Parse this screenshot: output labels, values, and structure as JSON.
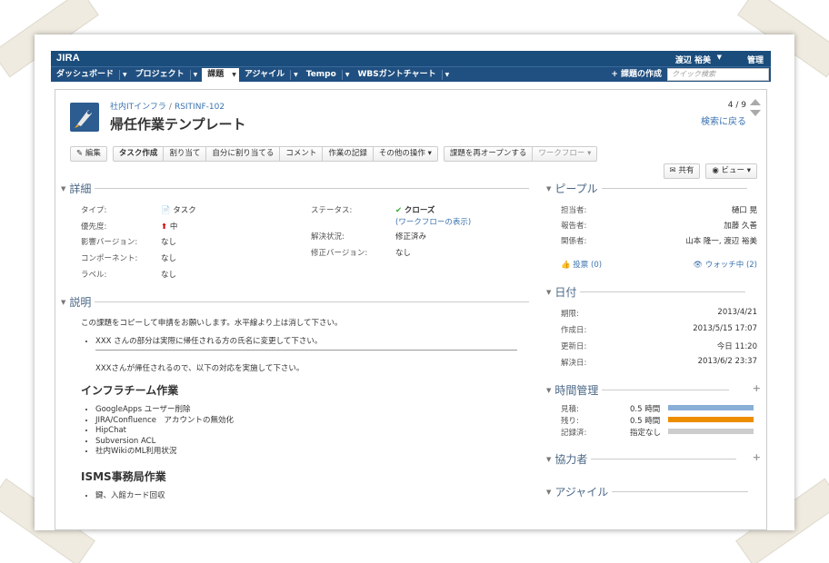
{
  "header": {
    "logo": "JIRA",
    "user": "渡辺 裕美",
    "admin": "管理"
  },
  "nav": {
    "items": [
      "ダッシュボード",
      "プロジェクト",
      "課題",
      "アジャイル",
      "Tempo",
      "WBSガントチャート"
    ],
    "create": "+ 課題の作成",
    "search_placeholder": "クイック検索"
  },
  "issue": {
    "project": "社内ITインフラ",
    "key": "RSITINF-102",
    "title": "帰任作業テンプレート",
    "position": "4 / 9",
    "back_to_search": "検索に戻る"
  },
  "toolbar": {
    "edit": "編集",
    "group1": [
      "タスク作成",
      "割り当て",
      "自分に割り当てる",
      "コメント",
      "作業の記録",
      "その他の操作 ▾"
    ],
    "reopen": "課題を再オープンする",
    "workflow": "ワークフロー ▾",
    "share": "共有",
    "view": "ビュー ▾"
  },
  "details": {
    "heading": "詳細",
    "left": [
      {
        "label": "タイプ:",
        "value": "タスク"
      },
      {
        "label": "優先度:",
        "value": "中"
      },
      {
        "label": "影響バージョン:",
        "value": "なし"
      },
      {
        "label": "コンポーネント:",
        "value": "なし"
      },
      {
        "label": "ラベル:",
        "value": "なし"
      }
    ],
    "right": [
      {
        "label": "ステータス:",
        "value": "クローズ"
      },
      {
        "label": "",
        "value": "(ワークフローの表示)"
      },
      {
        "label": "解決状況:",
        "value": "修正済み"
      },
      {
        "label": "修正バージョン:",
        "value": "なし"
      }
    ]
  },
  "description": {
    "heading": "説明",
    "intro": "この課題をコピーして申請をお願いします。水平線より上は消して下さい。",
    "bullet1": "XXX さんの部分は実際に帰任される方の氏名に変更して下さい。",
    "para": "XXXさんが帰任されるので、以下の対応を実施して下さい。",
    "h1": "インフラチーム作業",
    "list1": [
      "GoogleApps ユーザー削除",
      "JIRA/Confluence　アカウントの無効化",
      "HipChat",
      "Subversion ACL",
      "社内WikiのML利用状況"
    ],
    "h2": "ISMS事務局作業",
    "list2": [
      "鍵、入館カード回収"
    ]
  },
  "people": {
    "heading": "ピープル",
    "rows": [
      {
        "label": "担当者:",
        "value": "樋口 晃"
      },
      {
        "label": "報告者:",
        "value": "加藤 久善"
      },
      {
        "label": "関係者:",
        "value": "山本 隆一, 渡辺 裕美"
      }
    ],
    "votes": "投票 (0)",
    "watch": "ウォッチ中 (2)"
  },
  "dates": {
    "heading": "日付",
    "rows": [
      {
        "label": "期限:",
        "value": "2013/4/21"
      },
      {
        "label": "作成日:",
        "value": "2013/5/15 17:07"
      },
      {
        "label": "更新日:",
        "value": "今日 11:20"
      },
      {
        "label": "解決日:",
        "value": "2013/6/2 23:37"
      }
    ]
  },
  "time": {
    "heading": "時間管理",
    "rows": [
      {
        "label": "見積:",
        "value": "0.5 時間",
        "fill": 1.0,
        "color": "#89afd7"
      },
      {
        "label": "残り:",
        "value": "0.5 時間",
        "fill": 1.0,
        "color": "#ec8e00"
      },
      {
        "label": "記録済:",
        "value": "指定なし",
        "fill": 1.0,
        "color": "#cccccc"
      }
    ]
  },
  "collab": {
    "heading": "協力者"
  },
  "agile": {
    "heading": "アジャイル"
  }
}
